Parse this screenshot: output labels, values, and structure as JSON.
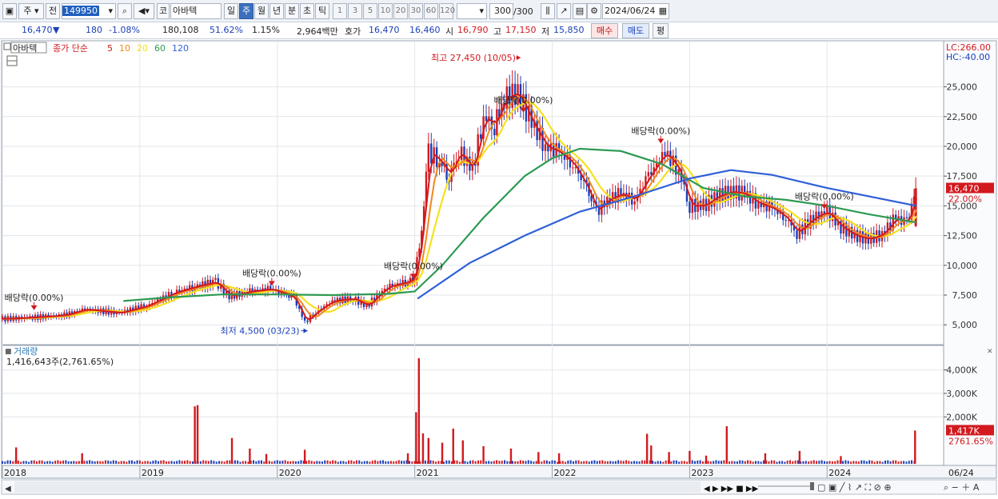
{
  "toolbar": {
    "market": "주",
    "prev": "전",
    "code": "149950",
    "code_prefix": "코",
    "stock_name": "아바텍",
    "periods": [
      "일",
      "주",
      "월",
      "년",
      "분",
      "초",
      "틱"
    ],
    "active_period": "주",
    "intervals": [
      "1",
      "3",
      "5",
      "10",
      "20",
      "30",
      "60",
      "120"
    ],
    "count": "300",
    "count_total": "/300",
    "date": "2024/06/24"
  },
  "quote": {
    "price": "16,470",
    "change": "180",
    "change_pct": "-1.08%",
    "volume": "180,108",
    "volume_ratio": "51.62%",
    "turnover": "1.15%",
    "amount": "2,964백만",
    "bid_label": "호가",
    "ask": "16,470",
    "bid": "16,460",
    "open_label": "시",
    "open": "16,790",
    "high_label": "고",
    "high": "17,150",
    "low_label": "저",
    "low": "15,850",
    "buy_label": "매수",
    "sell_label": "매도",
    "avg_label": "평"
  },
  "colors": {
    "up": "#d2191e",
    "down": "#1a3fb8",
    "ma5": "#d2191e",
    "ma10": "#f0881e",
    "ma20": "#f5e21e",
    "ma60": "#2e9a52",
    "ma120": "#2f5fd8"
  },
  "chart_data": {
    "type": "stock_chart",
    "legend_name": "아바텍",
    "legend_items": [
      {
        "label": "종가 단순",
        "color": "#d2191e"
      },
      {
        "label": "5",
        "color": "#d2191e"
      },
      {
        "label": "10",
        "color": "#f0881e"
      },
      {
        "label": "20",
        "color": "#f5e21e"
      },
      {
        "label": "60",
        "color": "#2e9a52"
      },
      {
        "label": "120",
        "color": "#2f5fd8"
      }
    ],
    "lc": "LC:266.00",
    "hc": "HC:-40.00",
    "price_ticks": [
      5000,
      7500,
      10000,
      12500,
      15000,
      17500,
      20000,
      22500,
      25000
    ],
    "price_tick_labels": [
      "5,000",
      "7,500",
      "10,000",
      "12,500",
      "15,000",
      "17,500",
      "20,000",
      "22,500",
      "25,000"
    ],
    "price_range": [
      3400,
      28600
    ],
    "current_price_label": "16,470",
    "current_pct_label": "22.00%",
    "current_price": 16470,
    "high_annotation": "최고 27,450 (10/05)",
    "low_annotation": "최저 4,500 (03/23)",
    "dividend_label": "배당락(0.00%)",
    "dividends": [
      {
        "date": 2018.23,
        "price": 6100
      },
      {
        "date": 2019.96,
        "price": 8150
      },
      {
        "date": 2020.99,
        "price": 8750
      },
      {
        "date": 2021.79,
        "price": 22700
      },
      {
        "date": 2022.79,
        "price": 20100
      },
      {
        "date": 2023.98,
        "price": 14600
      }
    ],
    "x_labels": [
      "2018",
      "2019",
      "2020",
      "2021",
      "2022",
      "2023",
      "2024",
      "06/24"
    ],
    "x_label_dates": [
      2018.0,
      2019.0,
      2020.0,
      2021.0,
      2022.0,
      2023.0,
      2024.0
    ],
    "x_range": [
      2018.0,
      2024.65
    ],
    "close_series": [
      [
        2018.0,
        5500
      ],
      [
        2018.2,
        5600
      ],
      [
        2018.45,
        5800
      ],
      [
        2018.6,
        6300
      ],
      [
        2018.85,
        6000
      ],
      [
        2019.05,
        6600
      ],
      [
        2019.25,
        7700
      ],
      [
        2019.4,
        8200
      ],
      [
        2019.55,
        8600
      ],
      [
        2019.65,
        7400
      ],
      [
        2019.8,
        7800
      ],
      [
        2019.95,
        8000
      ],
      [
        2020.05,
        7600
      ],
      [
        2020.12,
        7300
      ],
      [
        2020.2,
        5200
      ],
      [
        2020.28,
        6100
      ],
      [
        2020.4,
        7000
      ],
      [
        2020.55,
        7200
      ],
      [
        2020.65,
        6600
      ],
      [
        2020.8,
        8200
      ],
      [
        2020.95,
        8600
      ],
      [
        2021.0,
        9000
      ],
      [
        2021.05,
        13000
      ],
      [
        2021.1,
        19500
      ],
      [
        2021.18,
        18800
      ],
      [
        2021.25,
        17500
      ],
      [
        2021.32,
        19600
      ],
      [
        2021.42,
        18000
      ],
      [
        2021.5,
        22500
      ],
      [
        2021.58,
        21800
      ],
      [
        2021.65,
        24000
      ],
      [
        2021.75,
        24500
      ],
      [
        2021.85,
        22000
      ],
      [
        2021.95,
        20000
      ],
      [
        2022.05,
        19500
      ],
      [
        2022.15,
        18500
      ],
      [
        2022.25,
        16500
      ],
      [
        2022.32,
        14500
      ],
      [
        2022.4,
        15500
      ],
      [
        2022.5,
        16000
      ],
      [
        2022.6,
        15500
      ],
      [
        2022.7,
        17500
      ],
      [
        2022.82,
        19500
      ],
      [
        2022.92,
        18000
      ],
      [
        2023.0,
        15000
      ],
      [
        2023.1,
        15000
      ],
      [
        2023.2,
        15800
      ],
      [
        2023.3,
        16200
      ],
      [
        2023.4,
        16000
      ],
      [
        2023.5,
        15200
      ],
      [
        2023.6,
        14800
      ],
      [
        2023.7,
        14000
      ],
      [
        2023.78,
        12700
      ],
      [
        2023.9,
        14000
      ],
      [
        2024.0,
        14500
      ],
      [
        2024.1,
        13200
      ],
      [
        2024.2,
        12500
      ],
      [
        2024.3,
        12200
      ],
      [
        2024.4,
        12600
      ],
      [
        2024.5,
        14000
      ],
      [
        2024.58,
        13500
      ],
      [
        2024.65,
        16470
      ]
    ],
    "ma60_series": [
      [
        2018.88,
        7000
      ],
      [
        2019.2,
        7300
      ],
      [
        2019.6,
        7550
      ],
      [
        2020.0,
        7550
      ],
      [
        2020.4,
        7500
      ],
      [
        2020.8,
        7600
      ],
      [
        2021.0,
        7800
      ],
      [
        2021.2,
        10000
      ],
      [
        2021.5,
        14000
      ],
      [
        2021.8,
        17500
      ],
      [
        2022.0,
        19000
      ],
      [
        2022.2,
        19800
      ],
      [
        2022.5,
        19600
      ],
      [
        2022.8,
        18500
      ],
      [
        2023.1,
        16500
      ],
      [
        2023.4,
        15800
      ],
      [
        2023.7,
        15500
      ],
      [
        2024.0,
        15000
      ],
      [
        2024.3,
        14300
      ],
      [
        2024.65,
        13600
      ]
    ],
    "ma120_series": [
      [
        2021.02,
        7200
      ],
      [
        2021.4,
        10200
      ],
      [
        2021.8,
        12500
      ],
      [
        2022.2,
        14500
      ],
      [
        2022.6,
        15800
      ],
      [
        2023.0,
        17300
      ],
      [
        2023.3,
        18000
      ],
      [
        2023.6,
        17600
      ],
      [
        2024.0,
        16500
      ],
      [
        2024.65,
        15000
      ]
    ],
    "volume_title": "거래량",
    "volume_value_label": "1,416,643주(2,761.65%)",
    "volume_ticks": [
      2000000,
      3000000,
      4000000
    ],
    "volume_tick_labels": [
      "2,000K",
      "3,000K",
      "4,000K"
    ],
    "volume_range": [
      0,
      4600000
    ],
    "current_volume_label": "1,417K",
    "current_volume_pct_label": "2761.65%",
    "volume_spikes": [
      [
        2018.1,
        700000
      ],
      [
        2018.58,
        450000
      ],
      [
        2019.4,
        2450000
      ],
      [
        2019.42,
        2500000
      ],
      [
        2019.67,
        1100000
      ],
      [
        2019.8,
        650000
      ],
      [
        2019.92,
        420000
      ],
      [
        2020.2,
        600000
      ],
      [
        2020.95,
        450000
      ],
      [
        2021.01,
        2200000
      ],
      [
        2021.03,
        4500000
      ],
      [
        2021.06,
        1300000
      ],
      [
        2021.1,
        1100000
      ],
      [
        2021.2,
        900000
      ],
      [
        2021.28,
        1500000
      ],
      [
        2021.35,
        1000000
      ],
      [
        2021.5,
        750000
      ],
      [
        2021.7,
        650000
      ],
      [
        2021.9,
        500000
      ],
      [
        2022.05,
        450000
      ],
      [
        2022.69,
        1280000
      ],
      [
        2022.72,
        780000
      ],
      [
        2022.85,
        500000
      ],
      [
        2023.0,
        550000
      ],
      [
        2023.12,
        350000
      ],
      [
        2023.27,
        1600000
      ],
      [
        2023.55,
        450000
      ],
      [
        2023.8,
        550000
      ],
      [
        2024.1,
        330000
      ],
      [
        2024.64,
        1417000
      ]
    ],
    "bottom_controls": "◀ ▶ ▶▶ ■ ▶▶"
  }
}
